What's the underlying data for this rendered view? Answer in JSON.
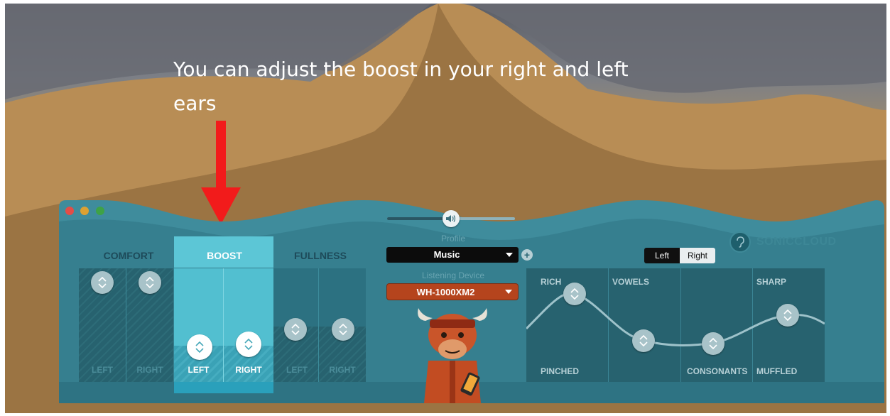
{
  "caption": {
    "line1": "You can adjust the boost in your right and left",
    "line2": "ears"
  },
  "window": {
    "controls": [
      "close",
      "minimize",
      "maximize"
    ]
  },
  "tabs": [
    {
      "label": "COMFORT",
      "active": false
    },
    {
      "label": "BOOST",
      "active": true
    },
    {
      "label": "FULLNESS",
      "active": false
    }
  ],
  "comfort": {
    "left_label": "LEFT",
    "right_label": "RIGHT"
  },
  "boost": {
    "left_label": "LEFT",
    "right_label": "RIGHT"
  },
  "fullness": {
    "left_label": "LEFT",
    "right_label": "RIGHT"
  },
  "profile": {
    "caption": "Profile",
    "value": "Music",
    "add_label": "+"
  },
  "device": {
    "caption": "Listening Device",
    "value": "WH-1000XM2"
  },
  "ear_toggle": {
    "left": "Left",
    "right": "Right",
    "selected": "Left"
  },
  "brand": {
    "name": "SONICCLOUD"
  },
  "tone": {
    "top_labels": [
      "RICH",
      "VOWELS",
      "SHARP"
    ],
    "bottom_labels": [
      "PINCHED",
      "CONSONANTS",
      "MUFFLED"
    ]
  },
  "icons": [
    "speaker-icon",
    "dropdown-caret-icon",
    "add-icon",
    "brand-ear-icon",
    "stepper-icon",
    "down-arrow-icon"
  ],
  "colors": {
    "accent": "#5cc6d6",
    "arrow": "#f21b1b",
    "device": "#b5441d"
  }
}
